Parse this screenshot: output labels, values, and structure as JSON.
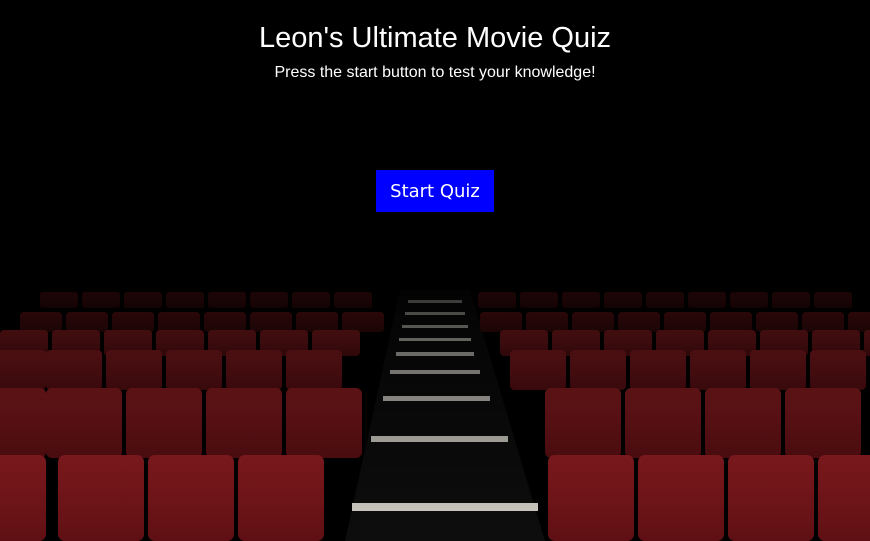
{
  "page": {
    "title": "Leon's Ultimate Movie Quiz",
    "subtitle": "Press the start button to test your knowledge!"
  },
  "start_button": {
    "label": "Start Quiz",
    "color": "#0000ff"
  },
  "background": {
    "image": "cinema-seats",
    "seat_color": "#8e1a1e",
    "base_color": "#000000"
  }
}
